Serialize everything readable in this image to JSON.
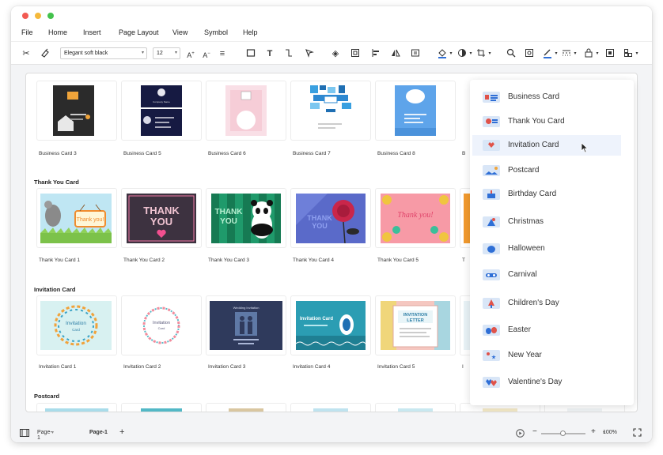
{
  "menu": [
    "File",
    "Home",
    "Insert",
    "Page Layout",
    "View",
    "Symbol",
    "Help"
  ],
  "toolbar": {
    "font_family": "Elegant soft black",
    "font_size": "12"
  },
  "icons": {
    "cut": "scissors-icon",
    "format_painter": "format-painter-icon",
    "grow_font": "font-grow-icon",
    "shrink_font": "font-shrink-icon",
    "align": "text-align-icon",
    "rect": "rectangle-icon",
    "text": "text-icon",
    "connector": "connector-icon",
    "pointer": "select-pointer-icon",
    "layers": "layers-icon",
    "group": "group-icon",
    "align_obj": "align-objects-icon",
    "flip": "flip-icon",
    "frame": "frame-icon",
    "fill": "fill-color-icon",
    "shape": "shape-style-icon",
    "crop": "crop-icon",
    "search": "search-icon",
    "find": "find-replace-icon",
    "line": "line-color-icon",
    "line_style": "line-style-icon",
    "lock": "lock-icon",
    "fit": "fit-icon",
    "more": "more-icon"
  },
  "sections": {
    "thank_you": "Thank You Card",
    "invitation": "Invitation Card",
    "postcard": "Postcard"
  },
  "captions": {
    "row1": [
      "Business Card 3",
      "Business Card 5",
      "Business Card 6",
      "Business Card 7",
      "Business Card 8",
      "B"
    ],
    "row2": [
      "Thank You Card 1",
      "Thank You Card 2",
      "Thank You Card 3",
      "Thank You Card 4",
      "Thank You Card 5",
      "T"
    ],
    "row3": [
      "Invitation Card 1",
      "Invitation Card 2",
      "Invitation Card 3",
      "Invitation Card 4",
      "Invitation Card 5",
      "I"
    ]
  },
  "thumb_text": {
    "company_name": "Company Name",
    "thank_you": "THANK YOU",
    "thank_you_script": "Thank you!",
    "invitation": "Invitation Card",
    "wedding": "Wedding Invitation",
    "invitation_letter": "INVITATION LETTER"
  },
  "dropdown": {
    "items": [
      {
        "label": "Business Card",
        "active": false
      },
      {
        "label": "Thank You Card",
        "active": false
      },
      {
        "label": "Invitation Card",
        "active": true
      },
      {
        "label": "Postcard",
        "active": false
      },
      {
        "label": "Birthday Card",
        "active": false
      },
      {
        "label": "Christmas",
        "active": false
      },
      {
        "label": "Halloween",
        "active": false
      },
      {
        "label": "Carnival",
        "active": false
      },
      {
        "label": "Children's Day",
        "active": false
      },
      {
        "label": "Easter",
        "active": false
      },
      {
        "label": "New Year",
        "active": false
      },
      {
        "label": "Valentine's Day",
        "active": false
      }
    ]
  },
  "status": {
    "page_select": "Page-1",
    "page_tab": "Page-1",
    "add_page": "+",
    "zoom": "100%",
    "zoom_minus": "−",
    "zoom_plus": "+"
  },
  "colors": {
    "accent": "#2f6fd6",
    "selected_row": "#eef3fc"
  }
}
